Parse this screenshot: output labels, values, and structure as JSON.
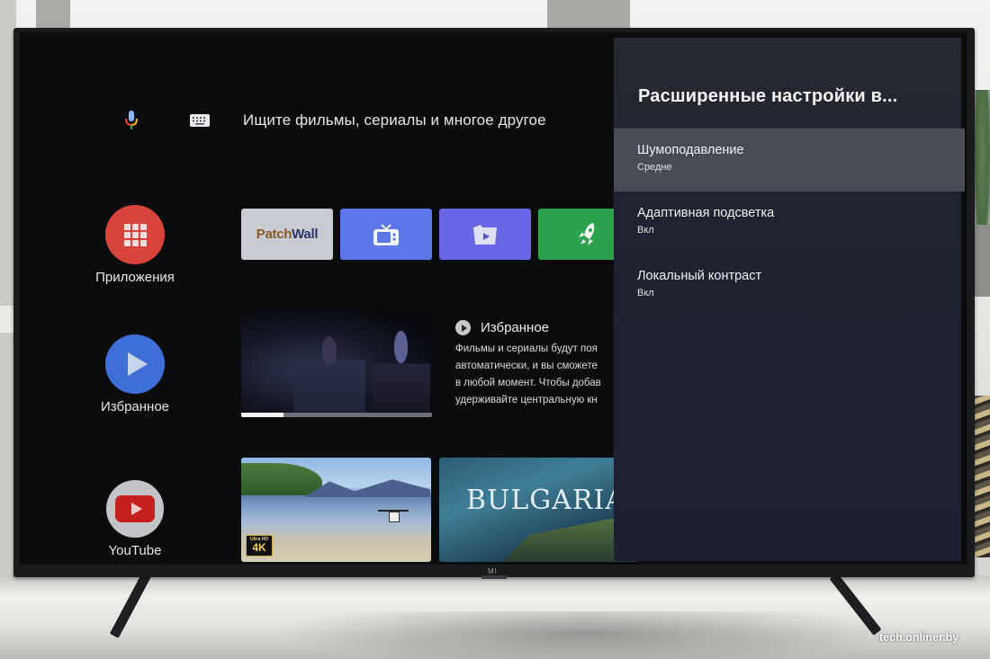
{
  "search": {
    "mic_icon": "microphone-icon",
    "keyboard_icon": "keyboard-icon",
    "placeholder": "Ищите фильмы, сериалы и многое другое"
  },
  "nav": {
    "items": [
      {
        "label": "Приложения",
        "icon": "apps-grid-icon",
        "color": "#d8443a"
      },
      {
        "label": "Избранное",
        "icon": "play-icon",
        "color": "#3e6fd6"
      },
      {
        "label": "YouTube",
        "icon": "youtube-icon",
        "color": "#c3c4c7"
      }
    ]
  },
  "apps": [
    {
      "name": "PatchWall",
      "logo_part1": "Patch",
      "logo_part2": "Wall",
      "color": "#c9cbd2"
    },
    {
      "name": "TV",
      "icon": "tv-icon",
      "color": "#5b78ea"
    },
    {
      "name": "Video",
      "icon": "video-folder-icon",
      "color": "#6a66e6"
    },
    {
      "name": "Launcher",
      "icon": "rocket-icon",
      "color": "#2ea14d"
    }
  ],
  "favorites": {
    "title": "Избранное",
    "description_lines": [
      "Фильмы и сериалы будут поя",
      "автоматически, и вы сможете",
      "в любой момент. Чтобы добав",
      "удерживайте центральную кн"
    ],
    "playback_progress_percent": 22
  },
  "thumbnails": [
    {
      "name": "lake-drone-4k",
      "badge_top": "Ultra HD",
      "badge_main": "4K"
    },
    {
      "name": "bulgaria",
      "title": "BULGARIA"
    }
  ],
  "settings": {
    "title": "Расширенные настройки в...",
    "items": [
      {
        "label": "Шумоподавление",
        "value": "Средне",
        "selected": true
      },
      {
        "label": "Адаптивная подсветка",
        "value": "Вкл",
        "selected": false
      },
      {
        "label": "Локальный контраст",
        "value": "Вкл",
        "selected": false
      }
    ]
  },
  "tv": {
    "brand": "MI"
  },
  "watermark": "tech.onliner.by"
}
